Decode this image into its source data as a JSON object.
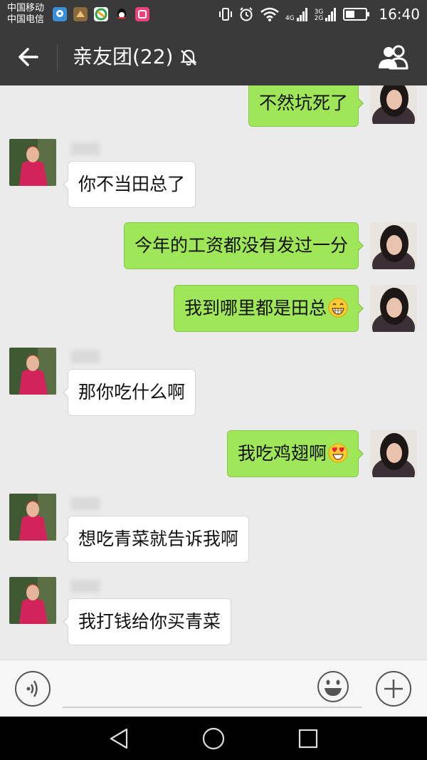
{
  "status_bar": {
    "carrier_1": "中国移动",
    "carrier_2": "中国电信",
    "net_top": "4G",
    "net2_top": "3G",
    "net2_bottom": "2G",
    "time": "16:40",
    "app_icons": [
      "location-app-icon",
      "game-app-icon",
      "browser-app-icon",
      "qq-app-icon",
      "shopping-app-icon"
    ]
  },
  "header": {
    "title": "亲友团(22)",
    "icons": [
      "back-arrow-icon",
      "mute-bell-icon",
      "group-members-icon"
    ]
  },
  "messages": [
    {
      "side": "out",
      "text": "不然坑死了"
    },
    {
      "side": "in",
      "text": "你不当田总了"
    },
    {
      "side": "out",
      "text": "今年的工资都没有发过一分"
    },
    {
      "side": "out",
      "text": "我到哪里都是田总",
      "emoji": "grin-emoji"
    },
    {
      "side": "in",
      "text": "那你吃什么啊"
    },
    {
      "side": "out",
      "text": "我吃鸡翅啊",
      "emoji": "heart-eyes-emoji"
    },
    {
      "side": "in",
      "text": "想吃青菜就告诉我啊"
    },
    {
      "side": "in",
      "text": "我打钱给你买青菜"
    }
  ],
  "input_bar": {
    "icons": [
      "voice-icon",
      "emoji-icon",
      "plus-icon"
    ]
  },
  "nav_bar": {
    "icons": [
      "nav-back-icon",
      "nav-home-icon",
      "nav-recents-icon"
    ]
  },
  "colors": {
    "bar_bg": "#3a3a3a",
    "chat_bg": "#ebebeb",
    "outgoing_bubble": "#9fe658",
    "incoming_bubble": "#ffffff"
  }
}
